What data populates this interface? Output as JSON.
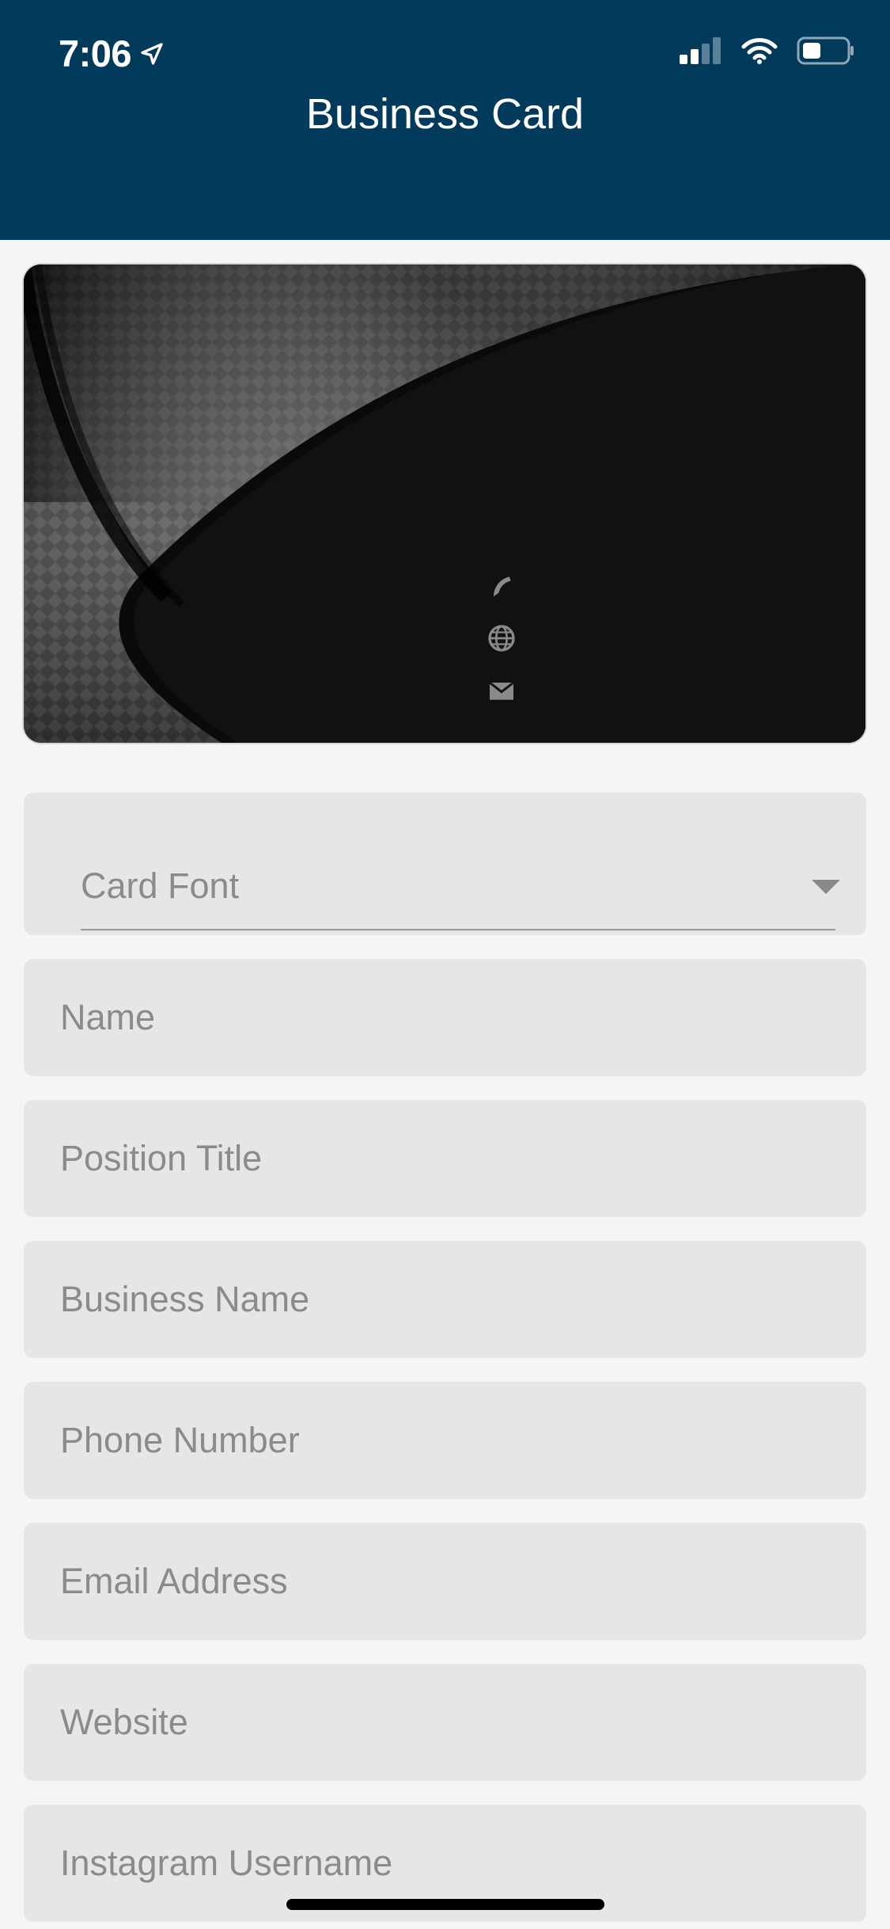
{
  "status_bar": {
    "time": "7:06",
    "signal_icon": "cellular-signal-icon",
    "wifi_icon": "wifi-icon",
    "battery_icon": "battery-icon",
    "location_icon": "location-arrow-icon"
  },
  "header": {
    "title": "Business Card",
    "background_color": "#023a5c"
  },
  "card_preview": {
    "icons": [
      "phone-icon",
      "globe-icon",
      "mail-icon"
    ]
  },
  "form": {
    "card_font": {
      "placeholder": "Card Font",
      "icon": "dropdown-caret-icon"
    },
    "fields": [
      {
        "placeholder": "Name"
      },
      {
        "placeholder": "Position Title"
      },
      {
        "placeholder": "Business Name"
      },
      {
        "placeholder": "Phone Number"
      },
      {
        "placeholder": "Email Address"
      },
      {
        "placeholder": "Website"
      },
      {
        "placeholder": "Instagram Username"
      }
    ]
  }
}
